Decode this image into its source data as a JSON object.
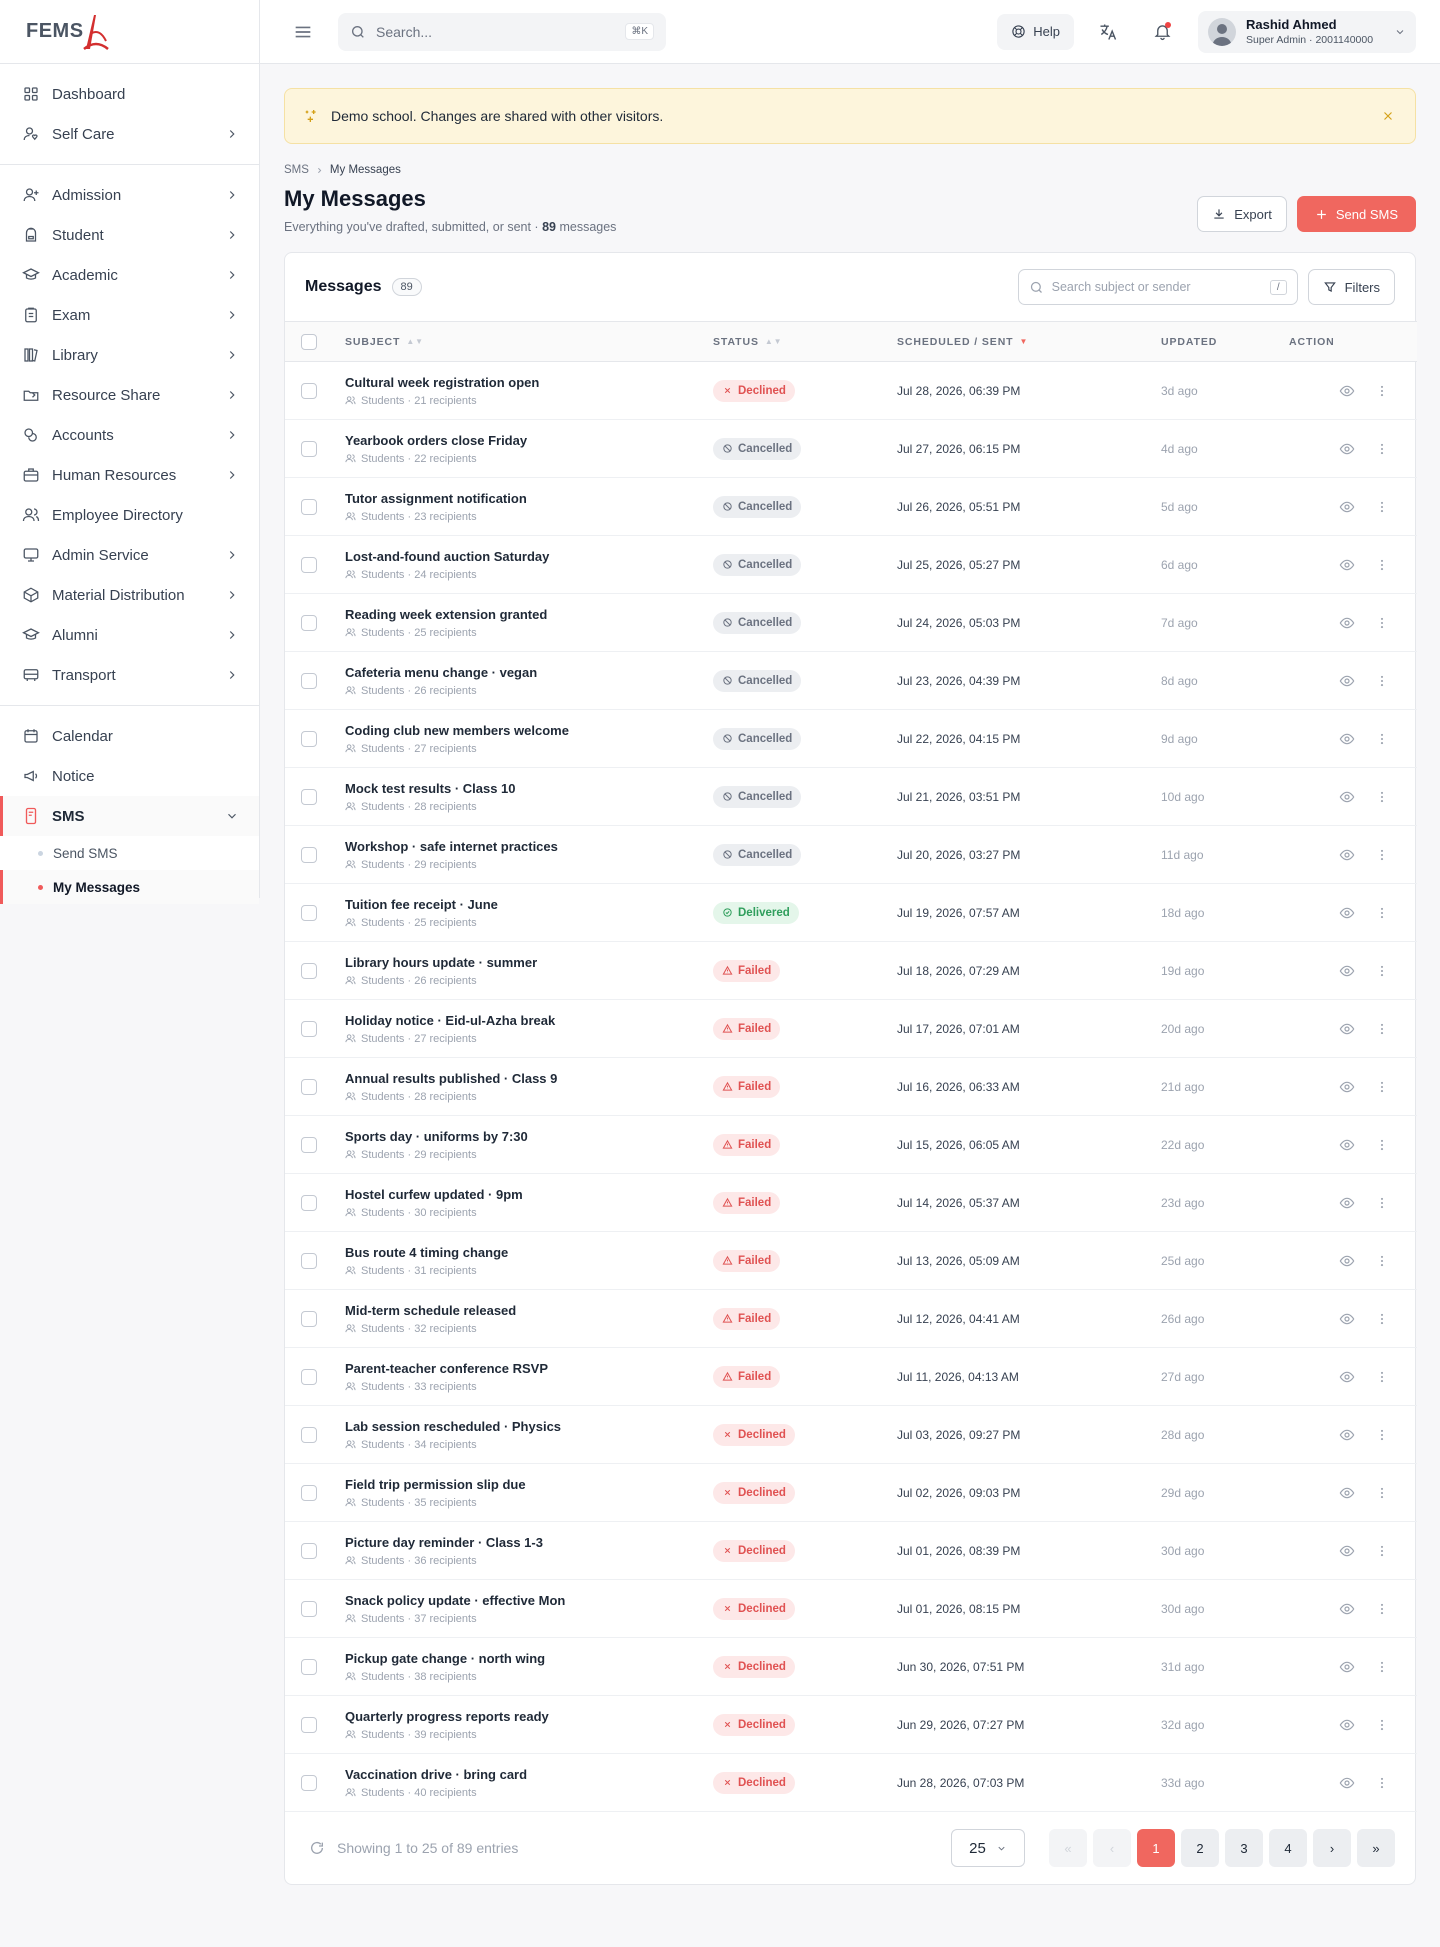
{
  "brand": {
    "name": "FEMS"
  },
  "sidebar": {
    "group1": [
      {
        "label": "Dashboard",
        "icon": "grid-icon",
        "chevron": false
      },
      {
        "label": "Self Care",
        "icon": "user-heart-icon",
        "chevron": true
      }
    ],
    "group2": [
      {
        "label": "Admission",
        "icon": "user-plus-icon",
        "chevron": true
      },
      {
        "label": "Student",
        "icon": "backpack-icon",
        "chevron": true
      },
      {
        "label": "Academic",
        "icon": "graduation-cap-icon",
        "chevron": true
      },
      {
        "label": "Exam",
        "icon": "clipboard-icon",
        "chevron": true
      },
      {
        "label": "Library",
        "icon": "books-icon",
        "chevron": true
      },
      {
        "label": "Resource Share",
        "icon": "folder-share-icon",
        "chevron": true
      },
      {
        "label": "Accounts",
        "icon": "coins-icon",
        "chevron": true
      },
      {
        "label": "Human Resources",
        "icon": "briefcase-icon",
        "chevron": true
      },
      {
        "label": "Employee Directory",
        "icon": "users-icon",
        "chevron": false
      },
      {
        "label": "Admin Service",
        "icon": "monitor-icon",
        "chevron": true
      },
      {
        "label": "Material Distribution",
        "icon": "box-icon",
        "chevron": true
      },
      {
        "label": "Alumni",
        "icon": "graduation-cap-icon",
        "chevron": true
      },
      {
        "label": "Transport",
        "icon": "bus-icon",
        "chevron": true
      }
    ],
    "group3": [
      {
        "label": "Calendar",
        "icon": "calendar-icon",
        "chevron": false
      },
      {
        "label": "Notice",
        "icon": "megaphone-icon",
        "chevron": false
      }
    ],
    "sms": {
      "label": "SMS",
      "icon": "message-phone-icon",
      "subs": [
        "Send SMS",
        "My Messages"
      ]
    }
  },
  "topbar": {
    "search_placeholder": "Search...",
    "shortcut": "⌘K",
    "help_label": "Help",
    "user_name": "Rashid Ahmed",
    "user_role": "Super Admin · 2001140000"
  },
  "banner": {
    "text": "Demo school. Changes are shared with other visitors."
  },
  "breadcrumb": [
    "SMS",
    "My Messages"
  ],
  "page": {
    "title": "My Messages",
    "subtitle_prefix": "Everything you've drafted, submitted, or sent · ",
    "subtitle_count": "89",
    "subtitle_suffix": " messages",
    "export_label": "Export",
    "send_label": "Send SMS"
  },
  "table": {
    "title": "Messages",
    "count": "89",
    "search_placeholder": "Search subject or sender",
    "search_shortcut": "/",
    "filters_label": "Filters",
    "columns": [
      "Subject",
      "Status",
      "Scheduled / Sent",
      "Updated",
      "Action"
    ],
    "status_colors": {
      "Declined": "#e05252",
      "Cancelled": "#6b7280",
      "Delivered": "#2f9e5c",
      "Failed": "#e05252"
    },
    "rows": [
      {
        "subject": "Cultural week registration open",
        "meta": "Students · 21 recipients",
        "status": "Declined",
        "sent": "Jul 28, 2026, 06:39 PM",
        "updated": "3d ago"
      },
      {
        "subject": "Yearbook orders close Friday",
        "meta": "Students · 22 recipients",
        "status": "Cancelled",
        "sent": "Jul 27, 2026, 06:15 PM",
        "updated": "4d ago"
      },
      {
        "subject": "Tutor assignment notification",
        "meta": "Students · 23 recipients",
        "status": "Cancelled",
        "sent": "Jul 26, 2026, 05:51 PM",
        "updated": "5d ago"
      },
      {
        "subject": "Lost-and-found auction Saturday",
        "meta": "Students · 24 recipients",
        "status": "Cancelled",
        "sent": "Jul 25, 2026, 05:27 PM",
        "updated": "6d ago"
      },
      {
        "subject": "Reading week extension granted",
        "meta": "Students · 25 recipients",
        "status": "Cancelled",
        "sent": "Jul 24, 2026, 05:03 PM",
        "updated": "7d ago"
      },
      {
        "subject": "Cafeteria menu change · vegan",
        "meta": "Students · 26 recipients",
        "status": "Cancelled",
        "sent": "Jul 23, 2026, 04:39 PM",
        "updated": "8d ago"
      },
      {
        "subject": "Coding club new members welcome",
        "meta": "Students · 27 recipients",
        "status": "Cancelled",
        "sent": "Jul 22, 2026, 04:15 PM",
        "updated": "9d ago"
      },
      {
        "subject": "Mock test results · Class 10",
        "meta": "Students · 28 recipients",
        "status": "Cancelled",
        "sent": "Jul 21, 2026, 03:51 PM",
        "updated": "10d ago"
      },
      {
        "subject": "Workshop · safe internet practices",
        "meta": "Students · 29 recipients",
        "status": "Cancelled",
        "sent": "Jul 20, 2026, 03:27 PM",
        "updated": "11d ago"
      },
      {
        "subject": "Tuition fee receipt · June",
        "meta": "Students · 25 recipients",
        "status": "Delivered",
        "sent": "Jul 19, 2026, 07:57 AM",
        "updated": "18d ago"
      },
      {
        "subject": "Library hours update · summer",
        "meta": "Students · 26 recipients",
        "status": "Failed",
        "sent": "Jul 18, 2026, 07:29 AM",
        "updated": "19d ago"
      },
      {
        "subject": "Holiday notice · Eid-ul-Azha break",
        "meta": "Students · 27 recipients",
        "status": "Failed",
        "sent": "Jul 17, 2026, 07:01 AM",
        "updated": "20d ago"
      },
      {
        "subject": "Annual results published · Class 9",
        "meta": "Students · 28 recipients",
        "status": "Failed",
        "sent": "Jul 16, 2026, 06:33 AM",
        "updated": "21d ago"
      },
      {
        "subject": "Sports day · uniforms by 7:30",
        "meta": "Students · 29 recipients",
        "status": "Failed",
        "sent": "Jul 15, 2026, 06:05 AM",
        "updated": "22d ago"
      },
      {
        "subject": "Hostel curfew updated · 9pm",
        "meta": "Students · 30 recipients",
        "status": "Failed",
        "sent": "Jul 14, 2026, 05:37 AM",
        "updated": "23d ago"
      },
      {
        "subject": "Bus route 4 timing change",
        "meta": "Students · 31 recipients",
        "status": "Failed",
        "sent": "Jul 13, 2026, 05:09 AM",
        "updated": "25d ago"
      },
      {
        "subject": "Mid-term schedule released",
        "meta": "Students · 32 recipients",
        "status": "Failed",
        "sent": "Jul 12, 2026, 04:41 AM",
        "updated": "26d ago"
      },
      {
        "subject": "Parent-teacher conference RSVP",
        "meta": "Students · 33 recipients",
        "status": "Failed",
        "sent": "Jul 11, 2026, 04:13 AM",
        "updated": "27d ago"
      },
      {
        "subject": "Lab session rescheduled · Physics",
        "meta": "Students · 34 recipients",
        "status": "Declined",
        "sent": "Jul 03, 2026, 09:27 PM",
        "updated": "28d ago"
      },
      {
        "subject": "Field trip permission slip due",
        "meta": "Students · 35 recipients",
        "status": "Declined",
        "sent": "Jul 02, 2026, 09:03 PM",
        "updated": "29d ago"
      },
      {
        "subject": "Picture day reminder · Class 1-3",
        "meta": "Students · 36 recipients",
        "status": "Declined",
        "sent": "Jul 01, 2026, 08:39 PM",
        "updated": "30d ago"
      },
      {
        "subject": "Snack policy update · effective Mon",
        "meta": "Students · 37 recipients",
        "status": "Declined",
        "sent": "Jul 01, 2026, 08:15 PM",
        "updated": "30d ago"
      },
      {
        "subject": "Pickup gate change · north wing",
        "meta": "Students · 38 recipients",
        "status": "Declined",
        "sent": "Jun 30, 2026, 07:51 PM",
        "updated": "31d ago"
      },
      {
        "subject": "Quarterly progress reports ready",
        "meta": "Students · 39 recipients",
        "status": "Declined",
        "sent": "Jun 29, 2026, 07:27 PM",
        "updated": "32d ago"
      },
      {
        "subject": "Vaccination drive · bring card",
        "meta": "Students · 40 recipients",
        "status": "Declined",
        "sent": "Jun 28, 2026, 07:03 PM",
        "updated": "33d ago"
      }
    ]
  },
  "footer": {
    "showing": "Showing 1 to 25 of 89 entries",
    "per_page": "25",
    "pages": [
      "1",
      "2",
      "3",
      "4"
    ],
    "current_page": "1"
  },
  "colors": {
    "accent": "#f0675f",
    "banner_bg": "#fdf5dc"
  }
}
